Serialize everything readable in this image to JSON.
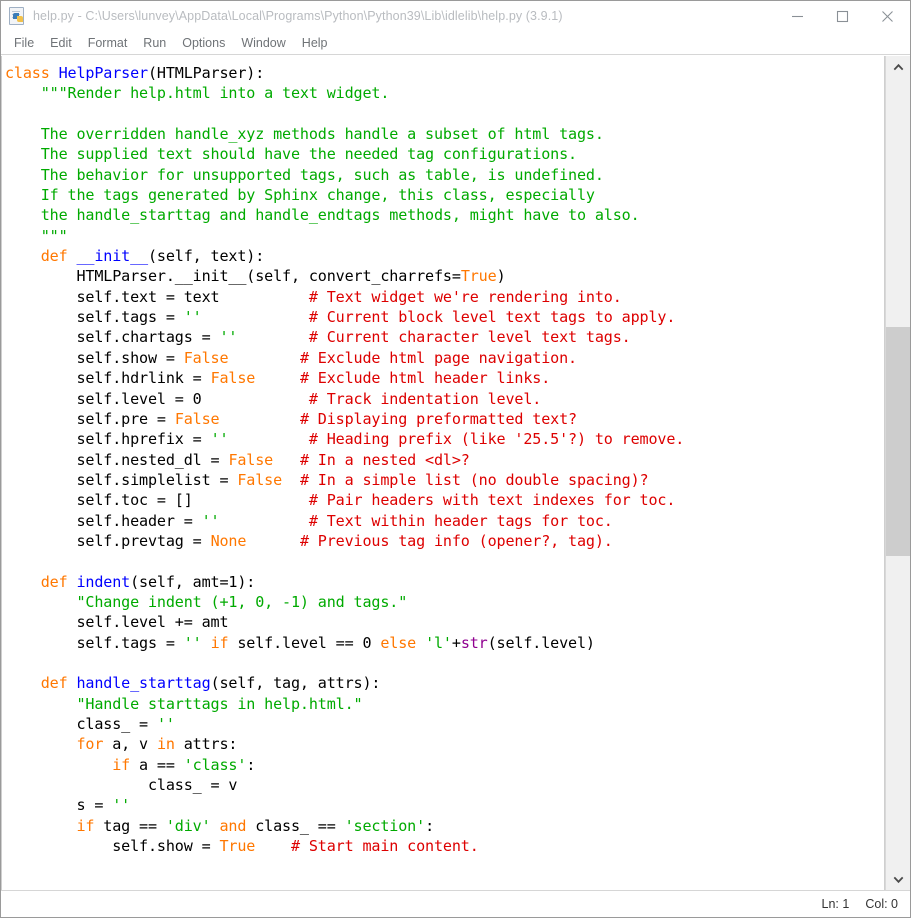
{
  "window": {
    "title": "help.py - C:\\Users\\lunvey\\AppData\\Local\\Programs\\Python\\Python39\\Lib\\idlelib\\help.py (3.9.1)",
    "icon": "python-file-icon",
    "controls": {
      "minimize": "minimize-icon",
      "maximize": "maximize-icon",
      "close": "close-icon"
    }
  },
  "menubar": {
    "items": [
      {
        "label": "File"
      },
      {
        "label": "Edit"
      },
      {
        "label": "Format"
      },
      {
        "label": "Run"
      },
      {
        "label": "Options"
      },
      {
        "label": "Window"
      },
      {
        "label": "Help"
      }
    ]
  },
  "colors": {
    "keyword": "#ff7700",
    "string": "#00aa00",
    "comment": "#dd0000",
    "definition": "#0000ff",
    "builtin": "#900090",
    "plain": "#000000",
    "background": "#ffffff",
    "scrollbar_thumb": "#cdcdcd",
    "scrollbar_track": "#f0f0f0"
  },
  "editor": {
    "language": "python",
    "filename": "help.py",
    "code_lines": [
      [
        {
          "t": "kw",
          "s": "class"
        },
        {
          "t": "plain",
          "s": " "
        },
        {
          "t": "def",
          "s": "HelpParser"
        },
        {
          "t": "plain",
          "s": "(HTMLParser):"
        }
      ],
      [
        {
          "t": "str",
          "s": "    \"\"\"Render help.html into a text widget."
        }
      ],
      [
        {
          "t": "str",
          "s": ""
        }
      ],
      [
        {
          "t": "str",
          "s": "    The overridden handle_xyz methods handle a subset of html tags."
        }
      ],
      [
        {
          "t": "str",
          "s": "    The supplied text should have the needed tag configurations."
        }
      ],
      [
        {
          "t": "str",
          "s": "    The behavior for unsupported tags, such as table, is undefined."
        }
      ],
      [
        {
          "t": "str",
          "s": "    If the tags generated by Sphinx change, this class, especially"
        }
      ],
      [
        {
          "t": "str",
          "s": "    the handle_starttag and handle_endtags methods, might have to also."
        }
      ],
      [
        {
          "t": "str",
          "s": "    \"\"\""
        }
      ],
      [
        {
          "t": "plain",
          "s": "    "
        },
        {
          "t": "kw",
          "s": "def"
        },
        {
          "t": "plain",
          "s": " "
        },
        {
          "t": "def",
          "s": "__init__"
        },
        {
          "t": "plain",
          "s": "(self, text):"
        }
      ],
      [
        {
          "t": "plain",
          "s": "        HTMLParser.__init__(self, convert_charrefs="
        },
        {
          "t": "kw",
          "s": "True"
        },
        {
          "t": "plain",
          "s": ")"
        }
      ],
      [
        {
          "t": "plain",
          "s": "        self.text = text          "
        },
        {
          "t": "com",
          "s": "# Text widget we're rendering into."
        }
      ],
      [
        {
          "t": "plain",
          "s": "        self.tags = "
        },
        {
          "t": "str",
          "s": "''"
        },
        {
          "t": "plain",
          "s": "            "
        },
        {
          "t": "com",
          "s": "# Current block level text tags to apply."
        }
      ],
      [
        {
          "t": "plain",
          "s": "        self.chartags = "
        },
        {
          "t": "str",
          "s": "''"
        },
        {
          "t": "plain",
          "s": "        "
        },
        {
          "t": "com",
          "s": "# Current character level text tags."
        }
      ],
      [
        {
          "t": "plain",
          "s": "        self.show = "
        },
        {
          "t": "kw",
          "s": "False"
        },
        {
          "t": "plain",
          "s": "        "
        },
        {
          "t": "com",
          "s": "# Exclude html page navigation."
        }
      ],
      [
        {
          "t": "plain",
          "s": "        self.hdrlink = "
        },
        {
          "t": "kw",
          "s": "False"
        },
        {
          "t": "plain",
          "s": "     "
        },
        {
          "t": "com",
          "s": "# Exclude html header links."
        }
      ],
      [
        {
          "t": "plain",
          "s": "        self.level = 0            "
        },
        {
          "t": "com",
          "s": "# Track indentation level."
        }
      ],
      [
        {
          "t": "plain",
          "s": "        self.pre = "
        },
        {
          "t": "kw",
          "s": "False"
        },
        {
          "t": "plain",
          "s": "         "
        },
        {
          "t": "com",
          "s": "# Displaying preformatted text?"
        }
      ],
      [
        {
          "t": "plain",
          "s": "        self.hprefix = "
        },
        {
          "t": "str",
          "s": "''"
        },
        {
          "t": "plain",
          "s": "         "
        },
        {
          "t": "com",
          "s": "# Heading prefix (like '25.5'?) to remove."
        }
      ],
      [
        {
          "t": "plain",
          "s": "        self.nested_dl = "
        },
        {
          "t": "kw",
          "s": "False"
        },
        {
          "t": "plain",
          "s": "   "
        },
        {
          "t": "com",
          "s": "# In a nested <dl>?"
        }
      ],
      [
        {
          "t": "plain",
          "s": "        self.simplelist = "
        },
        {
          "t": "kw",
          "s": "False"
        },
        {
          "t": "plain",
          "s": "  "
        },
        {
          "t": "com",
          "s": "# In a simple list (no double spacing)?"
        }
      ],
      [
        {
          "t": "plain",
          "s": "        self.toc = []             "
        },
        {
          "t": "com",
          "s": "# Pair headers with text indexes for toc."
        }
      ],
      [
        {
          "t": "plain",
          "s": "        self.header = "
        },
        {
          "t": "str",
          "s": "''"
        },
        {
          "t": "plain",
          "s": "          "
        },
        {
          "t": "com",
          "s": "# Text within header tags for toc."
        }
      ],
      [
        {
          "t": "plain",
          "s": "        self.prevtag = "
        },
        {
          "t": "kw",
          "s": "None"
        },
        {
          "t": "plain",
          "s": "      "
        },
        {
          "t": "com",
          "s": "# Previous tag info (opener?, tag)."
        }
      ],
      [
        {
          "t": "plain",
          "s": ""
        }
      ],
      [
        {
          "t": "plain",
          "s": "    "
        },
        {
          "t": "kw",
          "s": "def"
        },
        {
          "t": "plain",
          "s": " "
        },
        {
          "t": "def",
          "s": "indent"
        },
        {
          "t": "plain",
          "s": "(self, amt=1):"
        }
      ],
      [
        {
          "t": "plain",
          "s": "        "
        },
        {
          "t": "str",
          "s": "\"Change indent (+1, 0, -1) and tags.\""
        }
      ],
      [
        {
          "t": "plain",
          "s": "        self.level += amt"
        }
      ],
      [
        {
          "t": "plain",
          "s": "        self.tags = "
        },
        {
          "t": "str",
          "s": "''"
        },
        {
          "t": "plain",
          "s": " "
        },
        {
          "t": "kw",
          "s": "if"
        },
        {
          "t": "plain",
          "s": " self.level == 0 "
        },
        {
          "t": "kw",
          "s": "else"
        },
        {
          "t": "plain",
          "s": " "
        },
        {
          "t": "str",
          "s": "'l'"
        },
        {
          "t": "plain",
          "s": "+"
        },
        {
          "t": "bin",
          "s": "str"
        },
        {
          "t": "plain",
          "s": "(self.level)"
        }
      ],
      [
        {
          "t": "plain",
          "s": ""
        }
      ],
      [
        {
          "t": "plain",
          "s": "    "
        },
        {
          "t": "kw",
          "s": "def"
        },
        {
          "t": "plain",
          "s": " "
        },
        {
          "t": "def",
          "s": "handle_starttag"
        },
        {
          "t": "plain",
          "s": "(self, tag, attrs):"
        }
      ],
      [
        {
          "t": "plain",
          "s": "        "
        },
        {
          "t": "str",
          "s": "\"Handle starttags in help.html.\""
        }
      ],
      [
        {
          "t": "plain",
          "s": "        class_ = "
        },
        {
          "t": "str",
          "s": "''"
        }
      ],
      [
        {
          "t": "plain",
          "s": "        "
        },
        {
          "t": "kw",
          "s": "for"
        },
        {
          "t": "plain",
          "s": " a, v "
        },
        {
          "t": "kw",
          "s": "in"
        },
        {
          "t": "plain",
          "s": " attrs:"
        }
      ],
      [
        {
          "t": "plain",
          "s": "            "
        },
        {
          "t": "kw",
          "s": "if"
        },
        {
          "t": "plain",
          "s": " a == "
        },
        {
          "t": "str",
          "s": "'class'"
        },
        {
          "t": "plain",
          "s": ":"
        }
      ],
      [
        {
          "t": "plain",
          "s": "                class_ = v"
        }
      ],
      [
        {
          "t": "plain",
          "s": "        s = "
        },
        {
          "t": "str",
          "s": "''"
        }
      ],
      [
        {
          "t": "plain",
          "s": "        "
        },
        {
          "t": "kw",
          "s": "if"
        },
        {
          "t": "plain",
          "s": " tag == "
        },
        {
          "t": "str",
          "s": "'div'"
        },
        {
          "t": "plain",
          "s": " "
        },
        {
          "t": "kw",
          "s": "and"
        },
        {
          "t": "plain",
          "s": " class_ == "
        },
        {
          "t": "str",
          "s": "'section'"
        },
        {
          "t": "plain",
          "s": ":"
        }
      ],
      [
        {
          "t": "plain",
          "s": "            self.show = "
        },
        {
          "t": "kw",
          "s": "True"
        },
        {
          "t": "plain",
          "s": "    "
        },
        {
          "t": "com",
          "s": "# Start main content."
        }
      ]
    ]
  },
  "scrollbar": {
    "up_arrow": "chevron-up-icon",
    "down_arrow": "chevron-down-icon",
    "thumb_top_percent": 31.5,
    "thumb_height_percent": 29
  },
  "statusbar": {
    "line_label": "Ln: 1",
    "col_label": "Col: 0"
  }
}
